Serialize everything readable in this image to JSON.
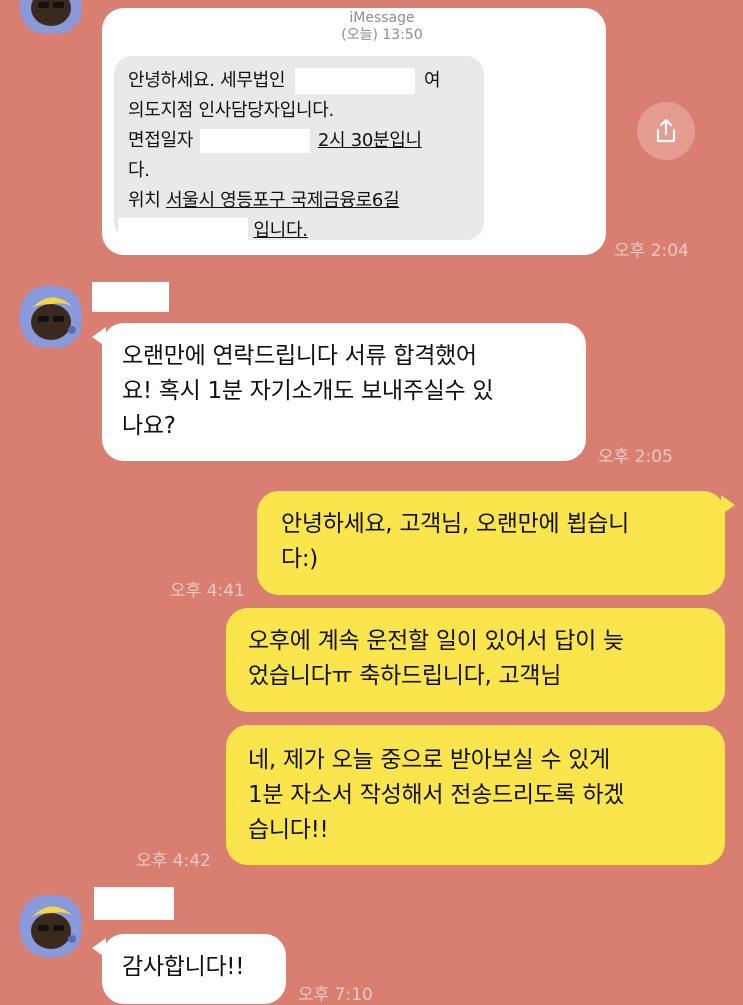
{
  "imessage": {
    "service": "iMessage",
    "date": "(오늘) 13:50",
    "line1_a": "안녕하세요. 세무법인",
    "line1_b": "여",
    "line2": "의도지점 인사담당자입니다.",
    "line3_a": "면접일자",
    "line3_b": "2시 30분입니",
    "line4": "다.",
    "line5_a": "위치",
    "line5_b": "서울시 영등포구 국제금융로6길",
    "line6_b": "입니다."
  },
  "messages": [
    {
      "time": "오후 2:04"
    },
    {
      "text": "오랜만에 연락드립니다 서류 합격했어\n요! 혹시 1분 자기소개도 보내주실수 있\n나요?",
      "time": "오후 2:05"
    },
    {
      "text": "안녕하세요, 고객님, 오랜만에 뵙습니\n다:)",
      "time": "오후 4:41"
    },
    {
      "text": "오후에 계속 운전할 일이 있어서 답이 늦\n었습니다ㅠ 축하드립니다, 고객님"
    },
    {
      "text": "네, 제가 오늘 중으로 받아보실 수 있게\n1분 자소서 작성해서 전송드리도록 하겠\n습니다!!",
      "time": "오후 4:42"
    },
    {
      "text": "감사합니다!!",
      "time": "오후 7:10"
    }
  ],
  "icons": {
    "share": "share-icon",
    "avatar": "avatar-character"
  },
  "colors": {
    "background": "#d97f72",
    "outgoing": "#fbe54d",
    "incoming": "#ffffff"
  }
}
